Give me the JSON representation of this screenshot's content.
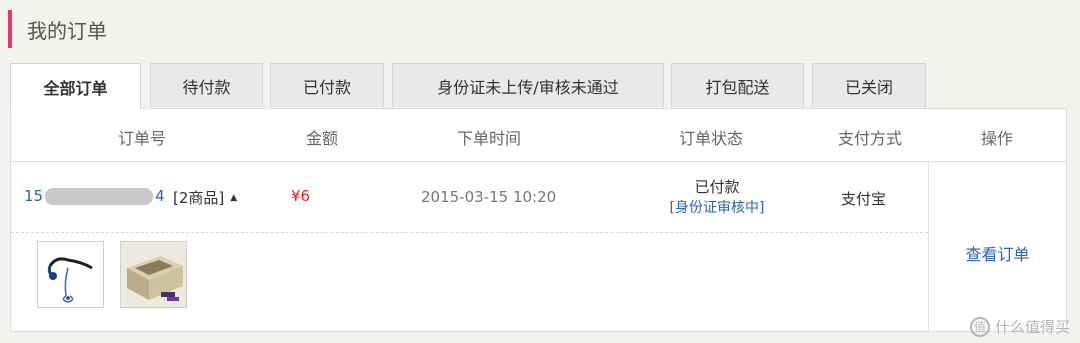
{
  "page": {
    "title": "我的订单"
  },
  "tabs": [
    {
      "label": "全部订单",
      "active": true
    },
    {
      "label": "待付款",
      "active": false
    },
    {
      "label": "已付款",
      "active": false
    },
    {
      "label": "身份证未上传/审核未通过",
      "active": false
    },
    {
      "label": "打包配送",
      "active": false
    },
    {
      "label": "已关闭",
      "active": false
    }
  ],
  "table": {
    "headers": [
      "订单号",
      "金额",
      "下单时间",
      "订单状态",
      "支付方式",
      "操作"
    ]
  },
  "order": {
    "number_prefix": "15",
    "number_suffix": "4",
    "item_count": "[2商品]",
    "amount": "¥6",
    "time": "2015-03-15 10:20",
    "status": "已付款",
    "status_detail": "[身份证审核中]",
    "payment": "支付宝",
    "action": "查看订单",
    "items": [
      {
        "icon": "earphones-image"
      },
      {
        "icon": "product-box-image"
      }
    ]
  },
  "watermark": {
    "icon": "zhi-icon",
    "text": "什么值得买"
  },
  "colors": {
    "accent": "#e8386e",
    "link": "#2a64b8",
    "price": "#e31f1f"
  }
}
